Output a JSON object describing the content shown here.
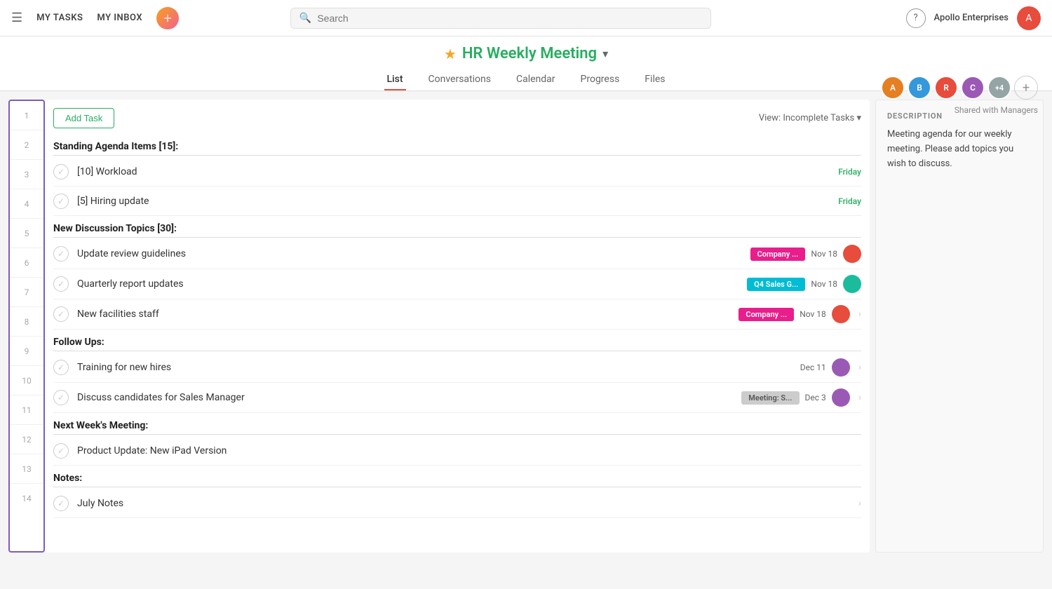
{
  "nav": {
    "my_tasks": "MY TASKS",
    "my_inbox": "MY INBOX",
    "search_placeholder": "Search",
    "company": "Apollo Enterprises",
    "help_icon": "?",
    "add_icon": "+"
  },
  "project": {
    "star": "★",
    "title": "HR Weekly Meeting",
    "chevron": "▾",
    "tabs": [
      "List",
      "Conversations",
      "Calendar",
      "Progress",
      "Files"
    ],
    "active_tab": "List",
    "shared_label": "Shared with Managers"
  },
  "members": [
    {
      "color": "av-orange",
      "initials": "A"
    },
    {
      "color": "av-blue",
      "initials": "B"
    },
    {
      "color": "av-red",
      "initials": "R"
    },
    {
      "color": "av-purple",
      "initials": "C"
    },
    {
      "color": "av-gray",
      "initials": "+4"
    }
  ],
  "toolbar": {
    "add_task_label": "Add Task",
    "view_label": "View: Incomplete Tasks ▾"
  },
  "description": {
    "title": "DESCRIPTION",
    "text": "Meeting agenda for our weekly meeting. Please add topics you wish to discuss."
  },
  "sections": [
    {
      "id": "section-1",
      "row": 1,
      "title": "Standing Agenda Items [15]:",
      "tasks": [
        {
          "row": 2,
          "name": "[10] Workload",
          "date": "Friday",
          "date_class": "friday",
          "tag": null,
          "has_avatar": false,
          "has_arrow": false
        },
        {
          "row": 3,
          "name": "[5] Hiring update",
          "date": "Friday",
          "date_class": "friday",
          "tag": null,
          "has_avatar": false,
          "has_arrow": false
        }
      ]
    },
    {
      "id": "section-2",
      "row": 4,
      "title": "New Discussion Topics [30]:",
      "tasks": [
        {
          "row": 5,
          "name": "Update review guidelines",
          "date": "Nov 18",
          "date_class": "",
          "tag": "Company ...",
          "tag_class": "tag-company",
          "has_avatar": true,
          "avatar_color": "av-red",
          "has_arrow": false
        },
        {
          "row": 6,
          "name": "Quarterly report updates",
          "date": "Nov 18",
          "date_class": "",
          "tag": "Q4 Sales G...",
          "tag_class": "tag-q4",
          "has_avatar": true,
          "avatar_color": "av-teal",
          "has_arrow": false
        },
        {
          "row": 7,
          "name": "New facilities staff",
          "date": "Nov 18",
          "date_class": "",
          "tag": "Company ...",
          "tag_class": "tag-company",
          "has_avatar": true,
          "avatar_color": "av-red",
          "has_arrow": true
        }
      ]
    },
    {
      "id": "section-3",
      "row": 8,
      "title": "Follow Ups:",
      "tasks": [
        {
          "row": 9,
          "name": "Training for new hires",
          "date": "Dec 11",
          "date_class": "",
          "tag": null,
          "has_avatar": true,
          "avatar_color": "av-purple",
          "has_arrow": true
        },
        {
          "row": 10,
          "name": "Discuss candidates for Sales Manager",
          "date": "Dec 3",
          "date_class": "",
          "tag": "Meeting: S...",
          "tag_class": "tag-meeting",
          "has_avatar": true,
          "avatar_color": "av-purple",
          "has_arrow": true
        }
      ]
    },
    {
      "id": "section-4",
      "row": 11,
      "title": "Next Week's Meeting:",
      "tasks": [
        {
          "row": 12,
          "name": "Product Update: New iPad Version",
          "date": "",
          "date_class": "",
          "tag": null,
          "has_avatar": false,
          "has_arrow": false
        }
      ]
    },
    {
      "id": "section-5",
      "row": 13,
      "title": "Notes:",
      "tasks": [
        {
          "row": 14,
          "name": "July Notes",
          "date": "",
          "date_class": "",
          "tag": null,
          "has_avatar": false,
          "has_arrow": true
        }
      ]
    }
  ],
  "row_numbers": [
    1,
    2,
    3,
    4,
    5,
    6,
    7,
    8,
    9,
    10,
    11,
    12,
    13,
    14
  ]
}
